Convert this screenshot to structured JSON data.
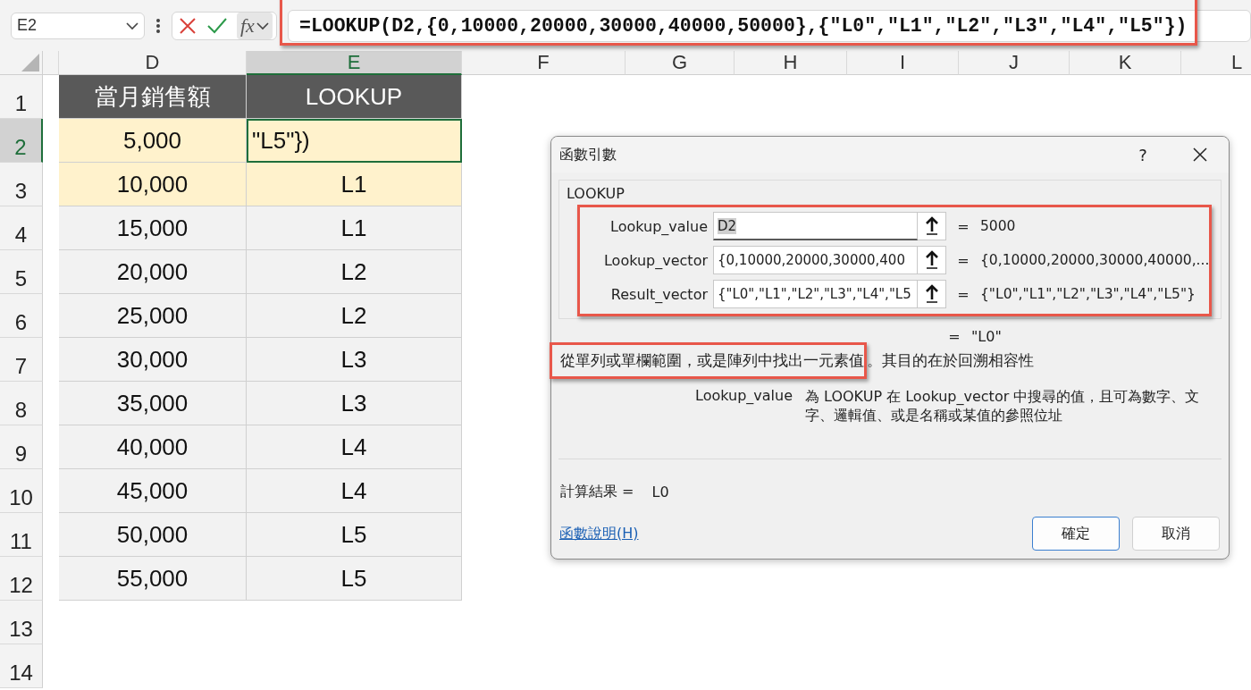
{
  "name_box": {
    "value": "E2"
  },
  "formula_bar": {
    "fx": "fx",
    "formula": "=LOOKUP(D2,{0,10000,20000,30000,40000,50000},{\"L0\",\"L1\",\"L2\",\"L3\",\"L4\",\"L5\"})"
  },
  "columns": [
    {
      "label": "D",
      "selected": false
    },
    {
      "label": "E",
      "selected": true
    },
    {
      "label": "F",
      "selected": false
    },
    {
      "label": "G",
      "selected": false
    },
    {
      "label": "H",
      "selected": false
    },
    {
      "label": "I",
      "selected": false
    },
    {
      "label": "J",
      "selected": false
    },
    {
      "label": "K",
      "selected": false
    },
    {
      "label": "L",
      "selected": false
    }
  ],
  "rows": [
    {
      "number": "1",
      "selected": false,
      "kind": "header",
      "cells": [
        "當月銷售額",
        "LOOKUP"
      ]
    },
    {
      "number": "2",
      "selected": true,
      "kind": "highlight",
      "cells": [
        "5,000",
        "\"L5\"})"
      ]
    },
    {
      "number": "3",
      "selected": false,
      "kind": "highlight",
      "cells": [
        "10,000",
        "L1"
      ]
    },
    {
      "number": "4",
      "selected": false,
      "kind": "plain",
      "cells": [
        "15,000",
        "L1"
      ]
    },
    {
      "number": "5",
      "selected": false,
      "kind": "plain",
      "cells": [
        "20,000",
        "L2"
      ]
    },
    {
      "number": "6",
      "selected": false,
      "kind": "plain",
      "cells": [
        "25,000",
        "L2"
      ]
    },
    {
      "number": "7",
      "selected": false,
      "kind": "plain",
      "cells": [
        "30,000",
        "L3"
      ]
    },
    {
      "number": "8",
      "selected": false,
      "kind": "plain",
      "cells": [
        "35,000",
        "L3"
      ]
    },
    {
      "number": "9",
      "selected": false,
      "kind": "plain",
      "cells": [
        "40,000",
        "L4"
      ]
    },
    {
      "number": "10",
      "selected": false,
      "kind": "plain",
      "cells": [
        "45,000",
        "L4"
      ]
    },
    {
      "number": "11",
      "selected": false,
      "kind": "plain",
      "cells": [
        "50,000",
        "L5"
      ]
    },
    {
      "number": "12",
      "selected": false,
      "kind": "plain",
      "cells": [
        "55,000",
        "L5"
      ]
    },
    {
      "number": "13",
      "selected": false,
      "kind": "empty",
      "cells": []
    },
    {
      "number": "14",
      "selected": false,
      "kind": "empty",
      "cells": []
    }
  ],
  "dialog": {
    "title": "函數引數",
    "help": "?",
    "function_name": "LOOKUP",
    "arguments": [
      {
        "label": "Lookup_value",
        "value": "D2",
        "selected": true,
        "result": "5000"
      },
      {
        "label": "Lookup_vector",
        "value": "{0,10000,20000,30000,400",
        "selected": false,
        "result": "{0,10000,20000,30000,40000,..."
      },
      {
        "label": "Result_vector",
        "value": "{\"L0\",\"L1\",\"L2\",\"L3\",\"L4\",\"L5",
        "selected": false,
        "result": "{\"L0\",\"L1\",\"L2\",\"L3\",\"L4\",\"L5\"}"
      }
    ],
    "equals": "=",
    "formula_value": "\"L0\"",
    "description": {
      "highlighted": "從單列或單欄範圍，或是陣列中找出一元素值",
      "rest": "。其目的在於回溯相容性"
    },
    "argument_help": {
      "name": "Lookup_value",
      "text": "為 LOOKUP 在 Lookup_vector 中搜尋的值，且可為數字、文字、邏輯值、或是名稱或某值的參照位址"
    },
    "result_label": "計算結果 =",
    "result_value": "L0",
    "help_link": "函數說明(H)",
    "buttons": [
      {
        "label": "確定",
        "default": true
      },
      {
        "label": "取消",
        "default": false
      }
    ]
  }
}
